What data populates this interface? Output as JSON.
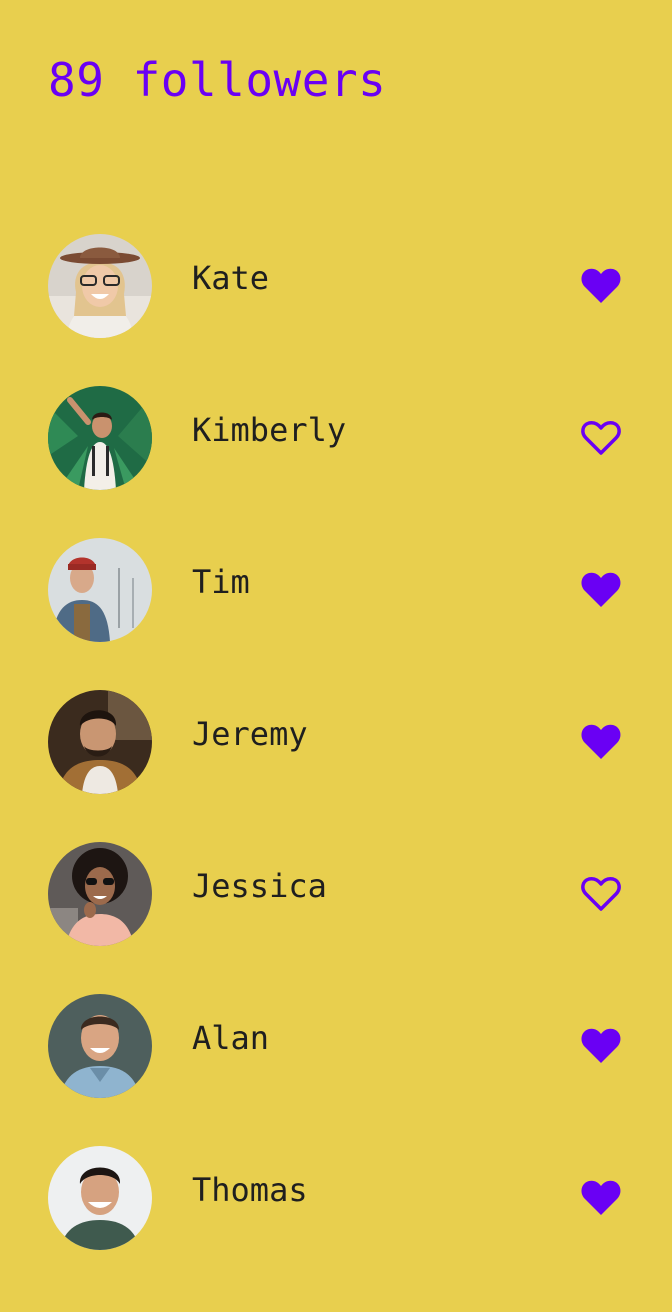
{
  "header": {
    "title": "89 followers"
  },
  "colors": {
    "background": "#e8cf4e",
    "accent": "#6a00f4",
    "text": "#1f1f1f"
  },
  "followers": [
    {
      "name": "Kate",
      "liked": true,
      "heart_icon": "heart-filled-icon"
    },
    {
      "name": "Kimberly",
      "liked": false,
      "heart_icon": "heart-outline-icon"
    },
    {
      "name": "Tim",
      "liked": true,
      "heart_icon": "heart-filled-icon"
    },
    {
      "name": "Jeremy",
      "liked": true,
      "heart_icon": "heart-filled-icon"
    },
    {
      "name": "Jessica",
      "liked": false,
      "heart_icon": "heart-outline-icon"
    },
    {
      "name": "Alan",
      "liked": true,
      "heart_icon": "heart-filled-icon"
    },
    {
      "name": "Thomas",
      "liked": true,
      "heart_icon": "heart-filled-icon"
    }
  ]
}
